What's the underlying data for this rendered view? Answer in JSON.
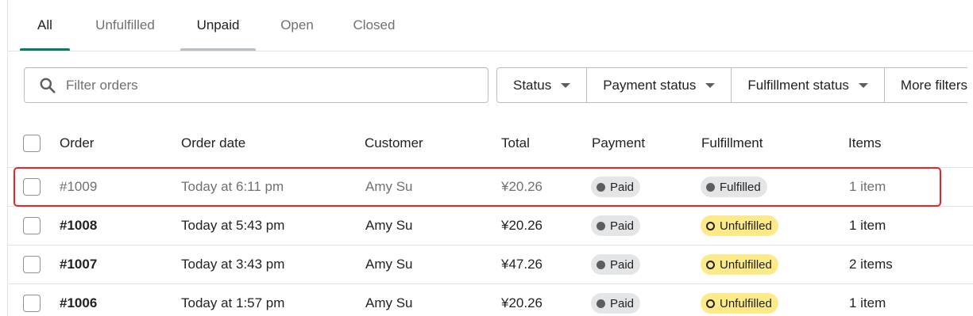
{
  "tabs": [
    {
      "label": "All"
    },
    {
      "label": "Unfulfilled"
    },
    {
      "label": "Unpaid"
    },
    {
      "label": "Open"
    },
    {
      "label": "Closed"
    }
  ],
  "search": {
    "placeholder": "Filter orders",
    "value": ""
  },
  "filters": [
    {
      "label": "Status"
    },
    {
      "label": "Payment status"
    },
    {
      "label": "Fulfillment status"
    },
    {
      "label": "More filters"
    }
  ],
  "table": {
    "columns": [
      "Order",
      "Order date",
      "Customer",
      "Total",
      "Payment",
      "Fulfillment",
      "Items"
    ],
    "rows": [
      {
        "order": "#1009",
        "date": "Today at 6:11 pm",
        "customer": "Amy Su",
        "total": "¥20.26",
        "payment": "Paid",
        "fulfillment": "Fulfilled",
        "items": "1 item"
      },
      {
        "order": "#1008",
        "date": "Today at 5:43 pm",
        "customer": "Amy Su",
        "total": "¥20.26",
        "payment": "Paid",
        "fulfillment": "Unfulfilled",
        "items": "1 item"
      },
      {
        "order": "#1007",
        "date": "Today at 3:43 pm",
        "customer": "Amy Su",
        "total": "¥47.26",
        "payment": "Paid",
        "fulfillment": "Unfulfilled",
        "items": "2 items"
      },
      {
        "order": "#1006",
        "date": "Today at 1:57 pm",
        "customer": "Amy Su",
        "total": "¥20.26",
        "payment": "Paid",
        "fulfillment": "Unfulfilled",
        "items": "1 item"
      }
    ]
  },
  "colors": {
    "active_tab": "#008060",
    "highlight": "#ee2222",
    "unfulfilled_badge": "#ffea8a",
    "neutral_badge": "#e4e5e7"
  }
}
